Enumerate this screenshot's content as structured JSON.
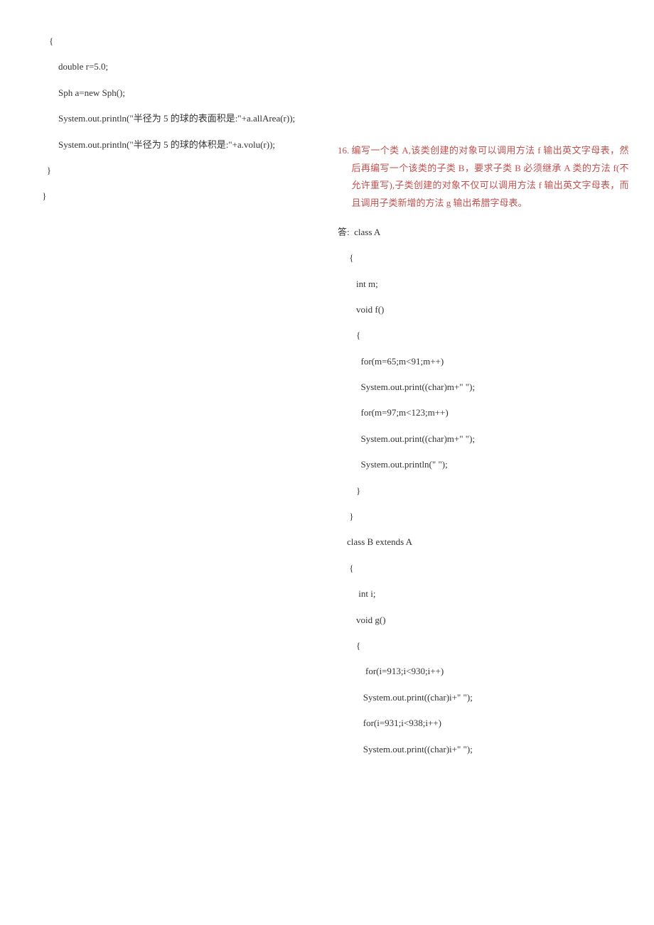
{
  "left": {
    "l1": "            {",
    "l2": "                double r=5.0;",
    "l3": "                Sph a=new Sph();",
    "l4": "                System.out.println(\"半径为 5 的球的表面积是:\"+a.allArea(r));",
    "l5": "                System.out.println(\"半径为 5 的球的体积是:\"+a.volu(r));",
    "l6": "           }",
    "l7": "         }"
  },
  "question": {
    "num": "16.",
    "text": "编写一个类 A,该类创建的对象可以调用方法 f 输出英文字母表，然后再编写一个该类的子类 B，要求子类 B 必须继承 A 类的方法 f(不允许重写),子类创建的对象不仅可以调用方法 f 输出英文字母表，而且调用子类新增的方法 g 输出希腊字母表。"
  },
  "right": {
    "r1": "答:  class A",
    "r2": "     {",
    "r3": "        int m;",
    "r4": "        void f()",
    "r5": "        {",
    "r6": "          for(m=65;m<91;m++)",
    "r7": "          System.out.print((char)m+\" \");",
    "r8": "          for(m=97;m<123;m++)",
    "r9": "          System.out.print((char)m+\" \");",
    "r10": "          System.out.println(\" \");",
    "r11": "        }",
    "r12": "     }",
    "r13": "    class B extends A",
    "r14": "     {",
    "r15": "         int i;",
    "r16": "        void g()",
    "r17": "        {",
    "r18": "            for(i=913;i<930;i++)",
    "r19": "           System.out.print((char)i+\" \");",
    "r20": "           for(i=931;i<938;i++)",
    "r21": "           System.out.print((char)i+\" \");"
  }
}
